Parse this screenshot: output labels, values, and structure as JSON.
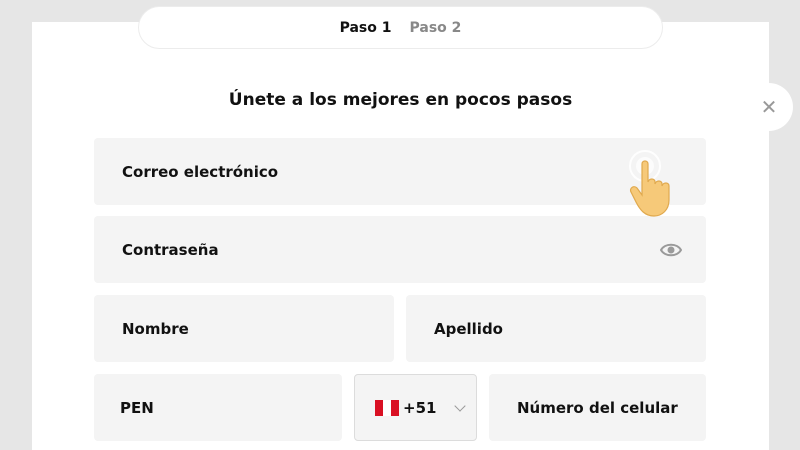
{
  "steps": {
    "step1": "Paso 1",
    "step2": "Paso 2"
  },
  "close": {
    "label": "✕"
  },
  "form": {
    "title": "Únete a los mejores en pocos pasos",
    "email_label": "Correo electrónico",
    "password_label": "Contraseña",
    "first_name_label": "Nombre",
    "last_name_label": "Apellido",
    "currency_value": "PEN",
    "country_code_value": "+51",
    "phone_label": "Número del celular"
  },
  "icons": {
    "password_toggle": "eye-icon",
    "close": "close-icon",
    "country_flag": "peru-flag-icon",
    "dropdown": "chevron-down-icon",
    "pointer": "tap-hand-icon"
  },
  "colors": {
    "field_bg": "#f4f4f4",
    "page_bg": "#e6e6e6",
    "flag_red": "#d91023",
    "hand": "#f6c979"
  }
}
